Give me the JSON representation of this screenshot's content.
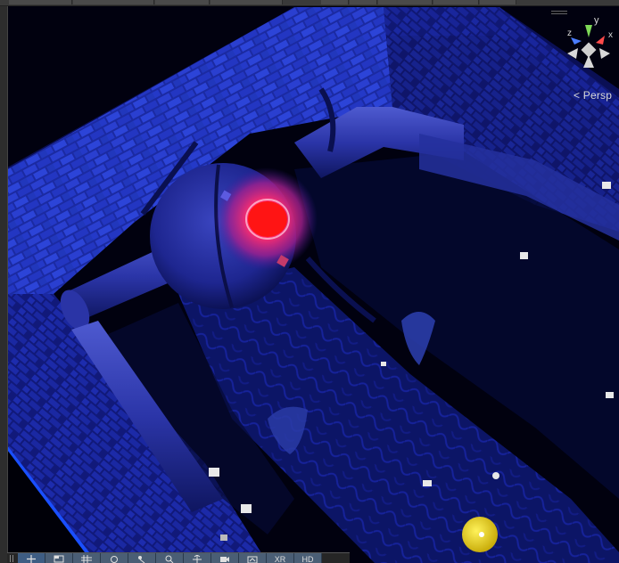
{
  "viewport": {
    "projection_label": "Persp",
    "gizmo_axes": {
      "y": "y",
      "x": "x",
      "z": "z"
    },
    "colors": {
      "background": "#01010f",
      "wall": "#1c2fb0",
      "wall_dark": "#0a1050",
      "floor": "#0d1665",
      "orb_glow": "#ff2e6a",
      "orb_core": "#ff1010",
      "light_gizmo": "#e9d21a",
      "edge_highlight": "#1a4fff"
    }
  },
  "toolbar": {
    "buttons": [
      {
        "name": "move-tool",
        "label": "",
        "icon": "move-icon"
      },
      {
        "name": "shaded-mode",
        "label": "",
        "icon": "shaded-icon"
      },
      {
        "name": "grid-toggle",
        "label": "",
        "icon": "grid-icon"
      },
      {
        "name": "orbit-tool",
        "label": "",
        "icon": "orbit-icon"
      },
      {
        "name": "gizmos-toggle",
        "label": "",
        "icon": "gizmo-icon"
      },
      {
        "name": "zoom-tool",
        "label": "",
        "icon": "magnifier-icon"
      },
      {
        "name": "transform-tool",
        "label": "",
        "icon": "transform-icon"
      },
      {
        "name": "camera-toggle",
        "label": "",
        "icon": "camera-icon"
      },
      {
        "name": "render-toggle",
        "label": "",
        "icon": "render-icon"
      },
      {
        "name": "xr-toggle",
        "label": "XR"
      },
      {
        "name": "hd-toggle",
        "label": "HD"
      }
    ]
  }
}
